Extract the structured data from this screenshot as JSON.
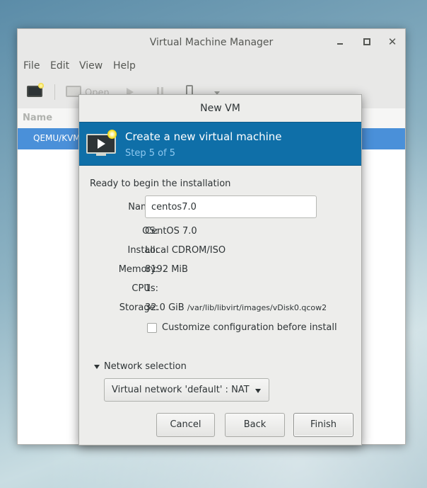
{
  "main_window": {
    "title": "Virtual Machine Manager",
    "menu": [
      "File",
      "Edit",
      "View",
      "Help"
    ],
    "toolbar": {
      "open_label": "Open"
    },
    "list": {
      "header": "Name",
      "rows": [
        "QEMU/KVM"
      ]
    }
  },
  "dialog": {
    "title": "New VM",
    "banner": {
      "title": "Create a new virtual machine",
      "step": "Step 5 of 5"
    },
    "ready_text": "Ready to begin the installation",
    "fields": {
      "name_label": "Name:",
      "name_value": "centos7.0",
      "os_label": "OS:",
      "os_value": "CentOS 7.0",
      "install_label": "Install:",
      "install_value": "Local CDROM/ISO",
      "memory_label": "Memory:",
      "memory_value": "8192 MiB",
      "cpus_label": "CPUs:",
      "cpus_value": "1",
      "storage_label": "Storage:",
      "storage_size": "32.0 GiB",
      "storage_path": "/var/lib/libvirt/images/vDisk0.qcow2"
    },
    "customize_label": "Customize configuration before install",
    "customize_checked": false,
    "network": {
      "label": "Network selection",
      "selected": "Virtual network 'default' : NAT"
    },
    "buttons": {
      "cancel": "Cancel",
      "back": "Back",
      "finish": "Finish"
    }
  },
  "colors": {
    "banner": "#0f6fa8",
    "selection": "#4a90d9",
    "step_text": "#8ec8ef"
  }
}
